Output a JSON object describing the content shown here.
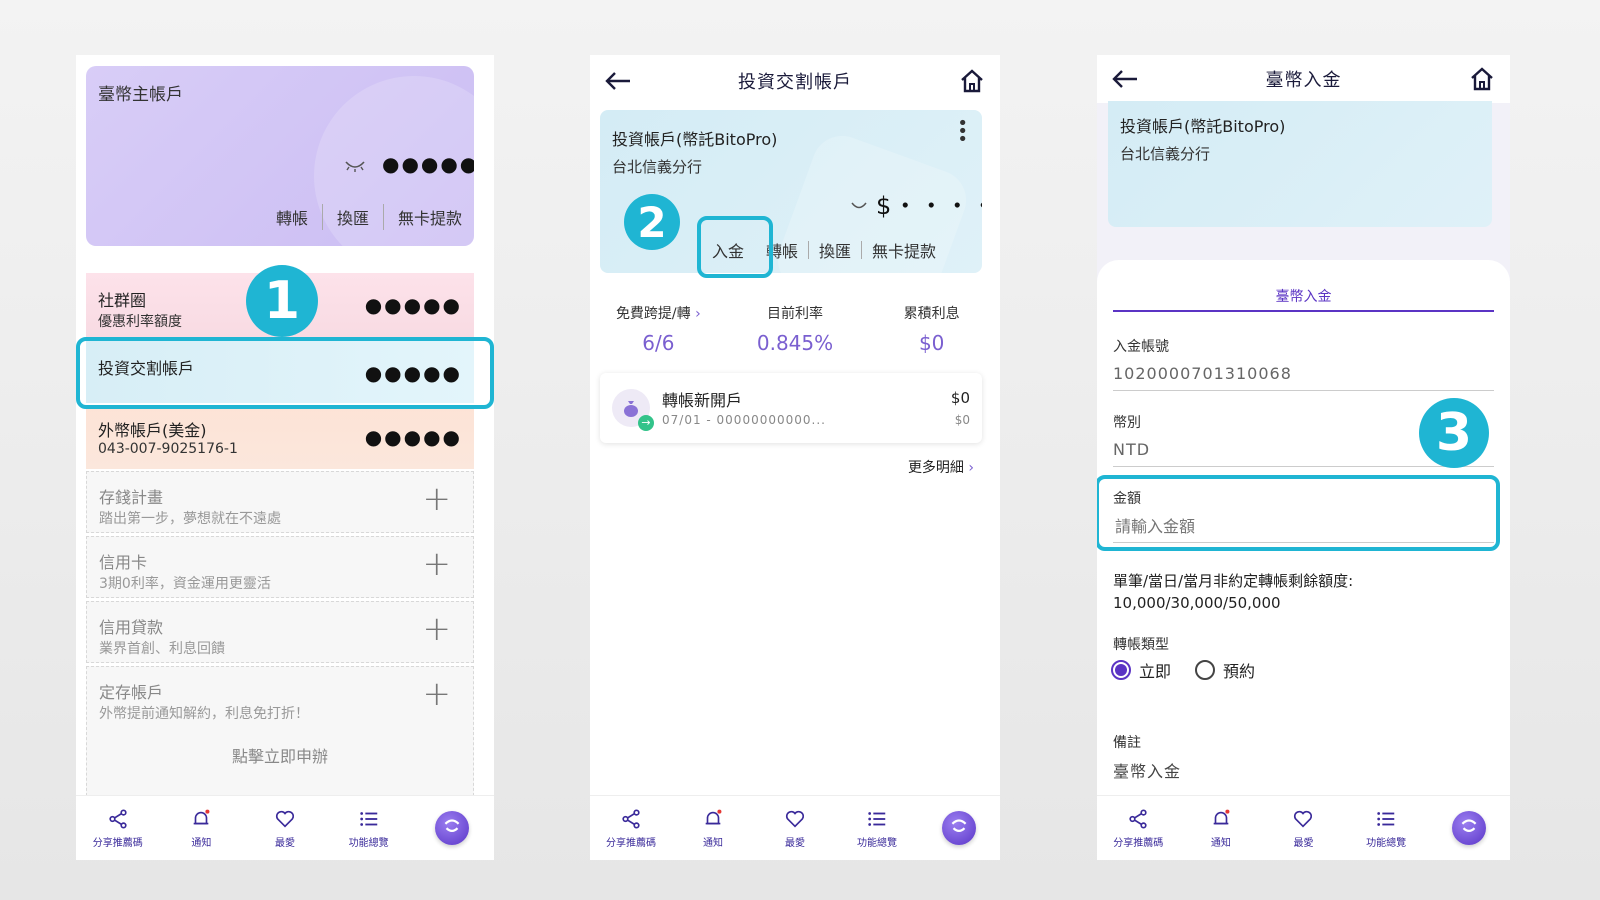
{
  "s1": {
    "main_card": {
      "title": "臺幣主帳戶",
      "masked": "●●●●●",
      "actions": [
        "轉帳",
        "換匯",
        "無卡提款"
      ]
    },
    "accounts": [
      {
        "title": "社群圈",
        "subtitle": "優惠利率額度",
        "masked": "●●●●●"
      },
      {
        "title": "投資交割帳戶",
        "subtitle": "",
        "masked": "●●●●●"
      },
      {
        "title": "外幣帳戶(美金)",
        "subtitle": "043-007-9025176-1",
        "masked": "●●●●●"
      }
    ],
    "promos": [
      {
        "title": "存錢計畫",
        "desc": "踏出第一步，夢想就在不遠處"
      },
      {
        "title": "信用卡",
        "desc": "3期0利率，資金運用更靈活"
      },
      {
        "title": "信用貸款",
        "desc": "業界首創、利息回饋"
      },
      {
        "title": "定存帳戶",
        "desc": "外幣提前通知解約，利息免打折！"
      }
    ],
    "apply_text": "點擊立即申辦",
    "badge": "1"
  },
  "s2": {
    "header_title": "投資交割帳戶",
    "card": {
      "name": "投資帳戶(幣託BitoPro)",
      "branch": "台北信義分行",
      "balance": "$・・・・・",
      "actions": [
        "入金",
        "轉帳",
        "換匯",
        "無卡提款"
      ]
    },
    "badge": "2",
    "stats": [
      {
        "label": "免費跨提/轉",
        "value": "6/6"
      },
      {
        "label": "目前利率",
        "value": "0.845%"
      },
      {
        "label": "累積利息",
        "value": "$0"
      }
    ],
    "transaction": {
      "title": "轉帳新開戶",
      "detail": "07/01 - 00000000000...",
      "amount": "$0",
      "balance": "$0"
    },
    "more": "更多明細"
  },
  "s3": {
    "header_title": "臺幣入金",
    "card": {
      "name": "投資帳戶(幣託BitoPro)",
      "branch": "台北信義分行"
    },
    "tab": "臺幣入金",
    "deposit_account_label": "入金帳號",
    "deposit_account_value": "1020000701310068",
    "currency_label": "幣別",
    "currency_value": "NTD",
    "amount_label": "金額",
    "amount_placeholder": "請輸入金額",
    "limit_label": "單筆/當日/當月非約定轉帳剩餘額度:",
    "limit_value": "10,000/30,000/50,000",
    "type_label": "轉帳類型",
    "type_options": [
      "立即",
      "預約"
    ],
    "note_label": "備註",
    "note_value": "臺幣入金",
    "badge": "3"
  },
  "nav": [
    "分享推薦碼",
    "通知",
    "最愛",
    "功能總覽"
  ],
  "colors": {
    "accent": "#1fb5d3",
    "purple": "#5b34c4",
    "stat_value": "#7a5fd0"
  }
}
